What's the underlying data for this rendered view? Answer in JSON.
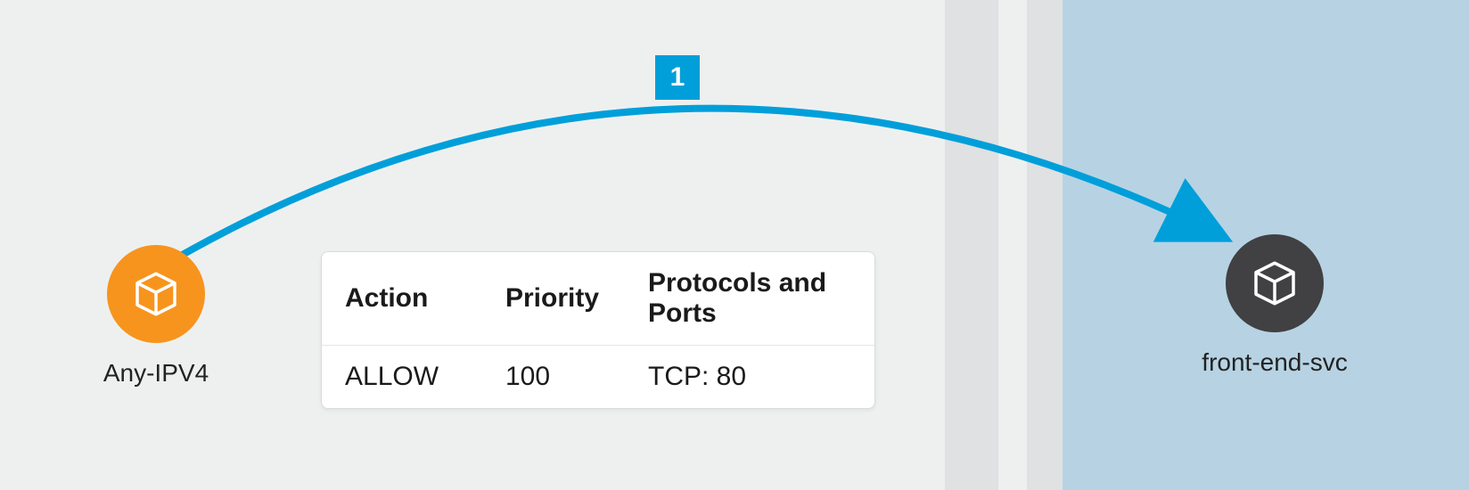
{
  "source_node": {
    "label": "Any-IPV4",
    "color": "#f7941d"
  },
  "destination_node": {
    "label": "front-end-svc",
    "color": "#414042"
  },
  "connection": {
    "badge": "1",
    "color": "#009fda"
  },
  "rule_table": {
    "headers": {
      "action": "Action",
      "priority": "Priority",
      "protocols": "Protocols and Ports"
    },
    "row": {
      "action": "ALLOW",
      "priority": "100",
      "protocols": "TCP: 80"
    }
  }
}
